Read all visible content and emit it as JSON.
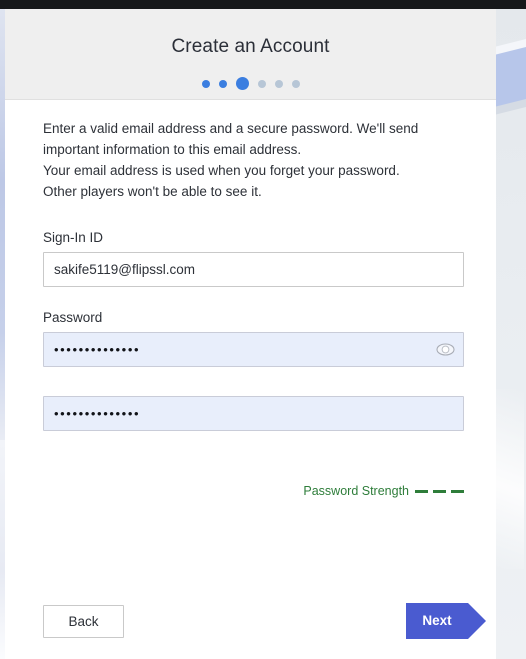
{
  "window": {
    "top_bar_color": "#16181a",
    "background_accent": "#b7c6ea"
  },
  "header": {
    "title": "Create an Account",
    "steps": {
      "total": 6,
      "current_index": 3,
      "states": [
        "done",
        "done",
        "active",
        "upcoming",
        "upcoming",
        "upcoming"
      ],
      "active_color": "#3b7ee0",
      "inactive_color": "#b7c6d6"
    }
  },
  "intro": {
    "line1": "Enter a valid email address and a secure password. We'll send",
    "line2": "important information to this email address.",
    "line3": "Your email address is used when you forget your password.",
    "line4": "Other players won't be able to see it."
  },
  "form": {
    "signin": {
      "label": "Sign-In ID",
      "value": "sakife5119@flipssl.com",
      "placeholder": ""
    },
    "password": {
      "label": "Password",
      "value": "••••••••••••••",
      "placeholder": "",
      "reveal_icon": "eye-icon"
    },
    "password_confirm": {
      "label": "",
      "value": "••••••••••••••",
      "placeholder": ""
    },
    "strength": {
      "label": "Password Strength",
      "filled_bars": 3,
      "total_bars": 3,
      "color": "#2e7d3a"
    }
  },
  "footer": {
    "back_label": "Back",
    "next_label": "Next",
    "next_color": "#4a5bd0"
  }
}
